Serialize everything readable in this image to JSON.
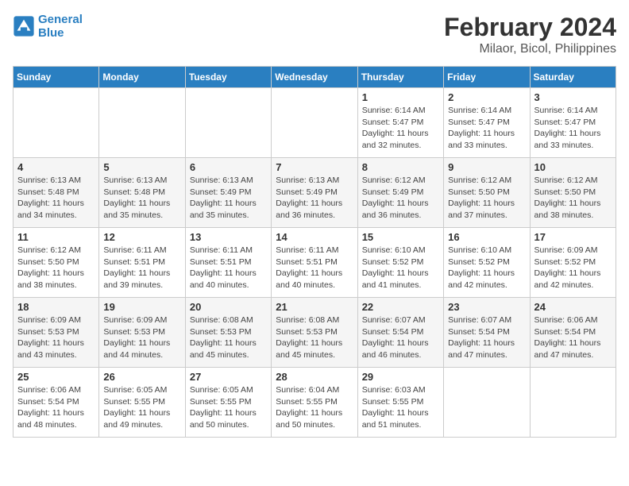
{
  "header": {
    "logo_line1": "General",
    "logo_line2": "Blue",
    "title": "February 2024",
    "subtitle": "Milaor, Bicol, Philippines"
  },
  "weekdays": [
    "Sunday",
    "Monday",
    "Tuesday",
    "Wednesday",
    "Thursday",
    "Friday",
    "Saturday"
  ],
  "weeks": [
    [
      {
        "day": "",
        "info": ""
      },
      {
        "day": "",
        "info": ""
      },
      {
        "day": "",
        "info": ""
      },
      {
        "day": "",
        "info": ""
      },
      {
        "day": "1",
        "info": "Sunrise: 6:14 AM\nSunset: 5:47 PM\nDaylight: 11 hours\nand 32 minutes."
      },
      {
        "day": "2",
        "info": "Sunrise: 6:14 AM\nSunset: 5:47 PM\nDaylight: 11 hours\nand 33 minutes."
      },
      {
        "day": "3",
        "info": "Sunrise: 6:14 AM\nSunset: 5:47 PM\nDaylight: 11 hours\nand 33 minutes."
      }
    ],
    [
      {
        "day": "4",
        "info": "Sunrise: 6:13 AM\nSunset: 5:48 PM\nDaylight: 11 hours\nand 34 minutes."
      },
      {
        "day": "5",
        "info": "Sunrise: 6:13 AM\nSunset: 5:48 PM\nDaylight: 11 hours\nand 35 minutes."
      },
      {
        "day": "6",
        "info": "Sunrise: 6:13 AM\nSunset: 5:49 PM\nDaylight: 11 hours\nand 35 minutes."
      },
      {
        "day": "7",
        "info": "Sunrise: 6:13 AM\nSunset: 5:49 PM\nDaylight: 11 hours\nand 36 minutes."
      },
      {
        "day": "8",
        "info": "Sunrise: 6:12 AM\nSunset: 5:49 PM\nDaylight: 11 hours\nand 36 minutes."
      },
      {
        "day": "9",
        "info": "Sunrise: 6:12 AM\nSunset: 5:50 PM\nDaylight: 11 hours\nand 37 minutes."
      },
      {
        "day": "10",
        "info": "Sunrise: 6:12 AM\nSunset: 5:50 PM\nDaylight: 11 hours\nand 38 minutes."
      }
    ],
    [
      {
        "day": "11",
        "info": "Sunrise: 6:12 AM\nSunset: 5:50 PM\nDaylight: 11 hours\nand 38 minutes."
      },
      {
        "day": "12",
        "info": "Sunrise: 6:11 AM\nSunset: 5:51 PM\nDaylight: 11 hours\nand 39 minutes."
      },
      {
        "day": "13",
        "info": "Sunrise: 6:11 AM\nSunset: 5:51 PM\nDaylight: 11 hours\nand 40 minutes."
      },
      {
        "day": "14",
        "info": "Sunrise: 6:11 AM\nSunset: 5:51 PM\nDaylight: 11 hours\nand 40 minutes."
      },
      {
        "day": "15",
        "info": "Sunrise: 6:10 AM\nSunset: 5:52 PM\nDaylight: 11 hours\nand 41 minutes."
      },
      {
        "day": "16",
        "info": "Sunrise: 6:10 AM\nSunset: 5:52 PM\nDaylight: 11 hours\nand 42 minutes."
      },
      {
        "day": "17",
        "info": "Sunrise: 6:09 AM\nSunset: 5:52 PM\nDaylight: 11 hours\nand 42 minutes."
      }
    ],
    [
      {
        "day": "18",
        "info": "Sunrise: 6:09 AM\nSunset: 5:53 PM\nDaylight: 11 hours\nand 43 minutes."
      },
      {
        "day": "19",
        "info": "Sunrise: 6:09 AM\nSunset: 5:53 PM\nDaylight: 11 hours\nand 44 minutes."
      },
      {
        "day": "20",
        "info": "Sunrise: 6:08 AM\nSunset: 5:53 PM\nDaylight: 11 hours\nand 45 minutes."
      },
      {
        "day": "21",
        "info": "Sunrise: 6:08 AM\nSunset: 5:53 PM\nDaylight: 11 hours\nand 45 minutes."
      },
      {
        "day": "22",
        "info": "Sunrise: 6:07 AM\nSunset: 5:54 PM\nDaylight: 11 hours\nand 46 minutes."
      },
      {
        "day": "23",
        "info": "Sunrise: 6:07 AM\nSunset: 5:54 PM\nDaylight: 11 hours\nand 47 minutes."
      },
      {
        "day": "24",
        "info": "Sunrise: 6:06 AM\nSunset: 5:54 PM\nDaylight: 11 hours\nand 47 minutes."
      }
    ],
    [
      {
        "day": "25",
        "info": "Sunrise: 6:06 AM\nSunset: 5:54 PM\nDaylight: 11 hours\nand 48 minutes."
      },
      {
        "day": "26",
        "info": "Sunrise: 6:05 AM\nSunset: 5:55 PM\nDaylight: 11 hours\nand 49 minutes."
      },
      {
        "day": "27",
        "info": "Sunrise: 6:05 AM\nSunset: 5:55 PM\nDaylight: 11 hours\nand 50 minutes."
      },
      {
        "day": "28",
        "info": "Sunrise: 6:04 AM\nSunset: 5:55 PM\nDaylight: 11 hours\nand 50 minutes."
      },
      {
        "day": "29",
        "info": "Sunrise: 6:03 AM\nSunset: 5:55 PM\nDaylight: 11 hours\nand 51 minutes."
      },
      {
        "day": "",
        "info": ""
      },
      {
        "day": "",
        "info": ""
      }
    ]
  ]
}
